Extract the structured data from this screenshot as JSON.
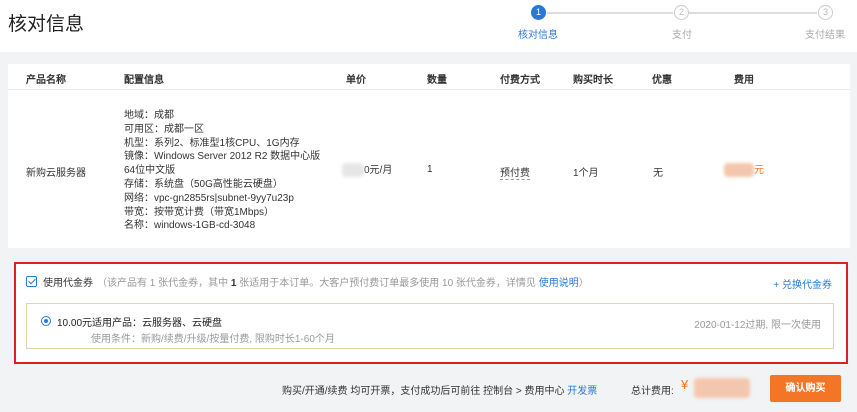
{
  "page": {
    "title": "核对信息"
  },
  "steps": [
    {
      "num": "1",
      "label": "核对信息",
      "state": "active"
    },
    {
      "num": "2",
      "label": "支付",
      "state": "todo"
    },
    {
      "num": "3",
      "label": "支付结果",
      "state": "todo"
    }
  ],
  "table": {
    "headers": [
      "产品名称",
      "配置信息",
      "单价",
      "数量",
      "付费方式",
      "购买时长",
      "优惠",
      "费用"
    ],
    "row": {
      "product": "新购云服务器",
      "config": [
        "地域：成都",
        "可用区：成都一区",
        "机型：系列2、标准型1核CPU、1G内存",
        "镜像：Windows Server 2012 R2 数据中心版",
        "64位中文版",
        "存储：系统盘（50G高性能云硬盘）",
        "网络：vpc-gn2855rs|subnet-9yy7u23p",
        "带宽：按带宽计费（带宽1Mbps）",
        "名称：windows-1GB-cd-3048"
      ],
      "price_suffix": "0元/月",
      "quantity": "1",
      "pay_type": "预付费",
      "duration": "1个月",
      "discount": "无",
      "cost_suffix": "元"
    }
  },
  "coupon": {
    "title": "使用代金券",
    "desc_prefix": "（该产品有 1 张代金券，其中 ",
    "desc_bold": "1",
    "desc_middle": " 张适用于本订单。大客户预付费订单最多使用 10 张代金券，详情见 ",
    "desc_link": "使用说明",
    "desc_suffix": "）",
    "exchange_link": "+ 兑换代金券",
    "item": {
      "name": "10.00元适用产品：云服务器、云硬盘",
      "condition": "使用条件：新购/续费/升级/按量付费, 限购时长1-60个月",
      "expire": "2020-01-12过期, 限一次使用"
    }
  },
  "footer": {
    "note": "购买/开通/续费 均可开票，支付成功后可前往 控制台 > 费用中心 ",
    "invoice_link": "开发票",
    "total_label": "总计费用:",
    "currency": "¥",
    "confirm_button": "确认购买"
  },
  "colors": {
    "accent": "#2878d8",
    "orange": "#f27625",
    "highlight_border": "#e02020"
  }
}
